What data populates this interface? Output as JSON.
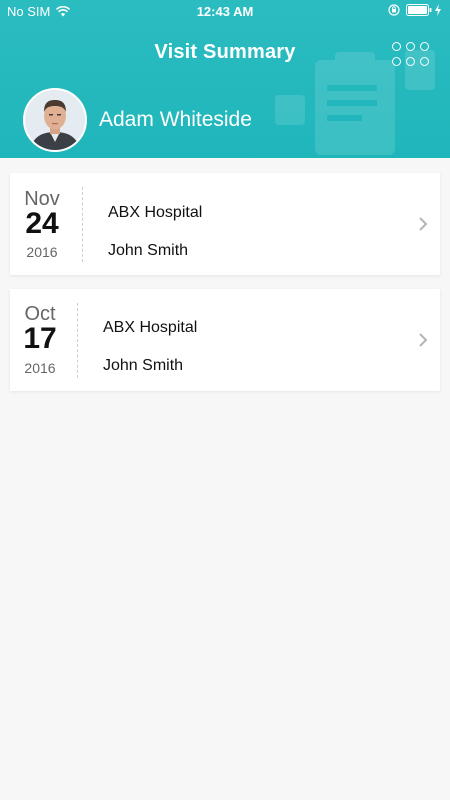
{
  "status_bar": {
    "carrier": "No SIM",
    "time": "12:43 AM"
  },
  "header": {
    "title": "Visit Summary",
    "user_name": "Adam Whiteside",
    "accent_color": "#1fb6bb"
  },
  "visits": [
    {
      "month": "Nov",
      "day": "24",
      "year": "2016",
      "hospital": "ABX Hospital",
      "doctor": "John Smith"
    },
    {
      "month": "Oct",
      "day": "17",
      "year": "2016",
      "hospital": "ABX Hospital",
      "doctor": "John Smith"
    }
  ],
  "icons": {
    "menu": "grid-dots-icon",
    "row_arrow": "chevron-right-icon",
    "wifi": "wifi-icon",
    "battery": "battery-icon"
  }
}
